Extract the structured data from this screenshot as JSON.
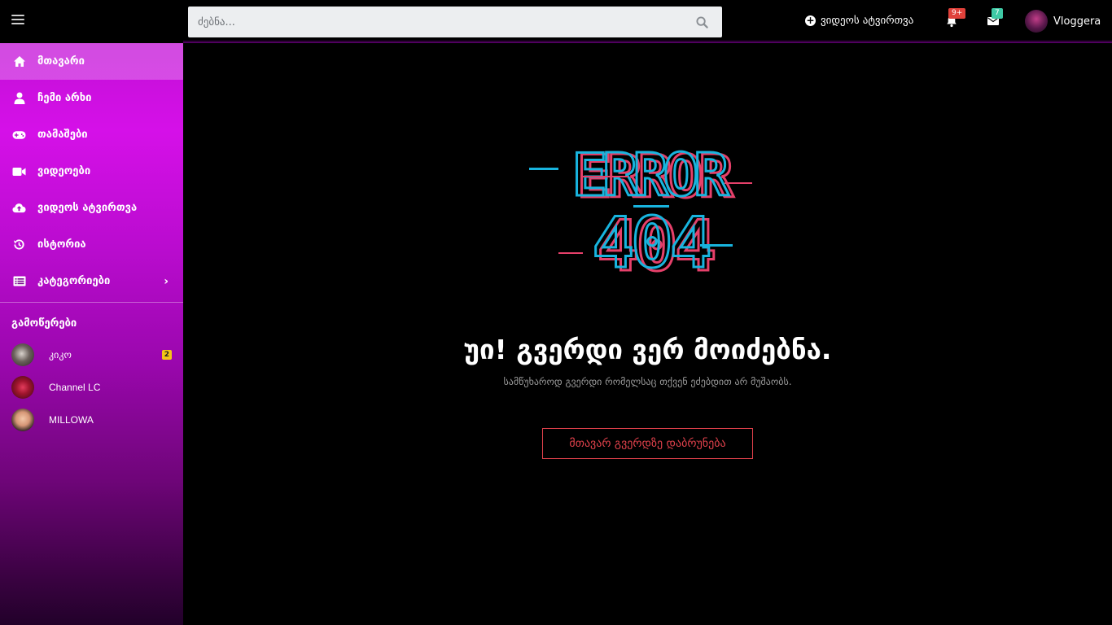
{
  "header": {
    "search": {
      "placeholder": "ძებნა..."
    },
    "upload_label": "ვიდეოს ატვირთვა",
    "notifications_badge": "9+",
    "messages_badge": "7",
    "username": "Vloggera"
  },
  "sidebar": {
    "items": [
      {
        "label": "მთავარი",
        "icon": "home-icon",
        "active": true
      },
      {
        "label": "ჩემი არხი",
        "icon": "user-icon"
      },
      {
        "label": "თამაშები",
        "icon": "gamepad-icon"
      },
      {
        "label": "ვიდეოები",
        "icon": "video-camera-icon"
      },
      {
        "label": "ვიდეოს ატვირთვა",
        "icon": "cloud-upload-icon"
      },
      {
        "label": "ისტორია",
        "icon": "history-icon"
      },
      {
        "label": "კატეგორიები",
        "icon": "list-icon"
      }
    ],
    "subscriptions_title": "გამოწერები",
    "subscriptions": [
      {
        "name": "კიკო",
        "count": "2"
      },
      {
        "name": "Channel LC"
      },
      {
        "name": "MILLOWA"
      }
    ]
  },
  "error": {
    "graphic_text": [
      "ERROR",
      "404"
    ],
    "title": "უი! გვერდი ვერ მოიძებნა.",
    "subtitle": "სამწუხაროდ გვერდი რომელსაც თქვენ ეძებდით არ მუშაობს.",
    "home_button": "მთავარ გვერდზე დაბრუნება"
  },
  "colors": {
    "accent": "#d510e8",
    "error_button": "#e0414b",
    "glitch_cyan": "#18b4de",
    "glitch_pink": "#e6406a"
  }
}
